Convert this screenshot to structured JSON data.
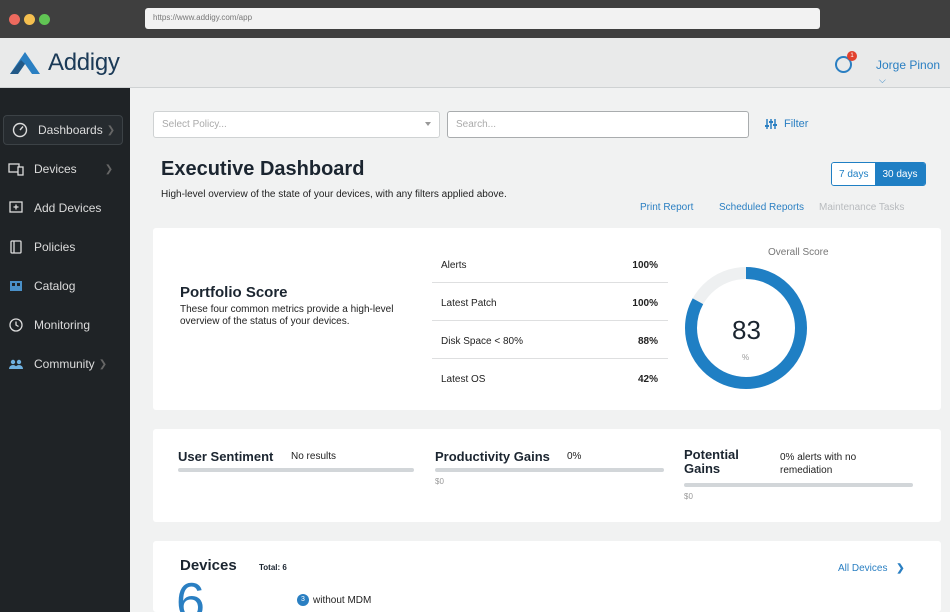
{
  "browser": {
    "url": "https://www.addigy.com/app"
  },
  "header": {
    "app_name": "Addigy",
    "notification_count": "1",
    "user_name": "Jorge Pinon"
  },
  "sidebar": {
    "items": [
      {
        "label": "Dashboards",
        "icon": "gauge-icon"
      },
      {
        "label": "Devices",
        "icon": "devices-icon"
      },
      {
        "label": "Add Devices",
        "icon": "add-device-icon"
      },
      {
        "label": "Policies",
        "icon": "policies-icon"
      },
      {
        "label": "Catalog",
        "icon": "catalog-icon"
      },
      {
        "label": "Monitoring",
        "icon": "clock-icon"
      },
      {
        "label": "Community",
        "icon": "people-icon"
      }
    ]
  },
  "filters": {
    "policy_placeholder": "Select Policy...",
    "search_placeholder": "Search...",
    "filter_label": "Filter"
  },
  "page": {
    "title": "Executive Dashboard",
    "subtitle": "High-level overview of the state of your devices, with any filters applied above.",
    "range_options": [
      "7 days",
      "30 days"
    ],
    "actions": {
      "print": "Print Report",
      "scheduled": "Scheduled Reports",
      "maintenance": "Maintenance Tasks"
    }
  },
  "portfolio": {
    "title": "Portfolio Score",
    "description": "These four common metrics provide a high-level overview of the status of your devices.",
    "metrics": [
      {
        "label": "Alerts",
        "value": "100%"
      },
      {
        "label": "Latest Patch",
        "value": "100%"
      },
      {
        "label": "Disk Space < 80%",
        "value": "88%"
      },
      {
        "label": "Latest OS",
        "value": "42%"
      }
    ],
    "overall_label": "Overall Score",
    "overall_score": "83",
    "overall_unit": "%",
    "overall_fraction": 0.83
  },
  "gains": {
    "user_sentiment": {
      "title": "User Sentiment",
      "side": "No results"
    },
    "productivity": {
      "title": "Productivity Gains",
      "side": "0%",
      "sub": "$0"
    },
    "potential": {
      "title": "Potential Gains",
      "side": "0% alerts with no remediation",
      "sub": "$0"
    }
  },
  "devices": {
    "title": "Devices",
    "total": "Total: 6",
    "all_link": "All Devices",
    "count": "6",
    "without_mdm_count": "3",
    "without_mdm_label": "without MDM"
  },
  "colors": {
    "accent": "#1f7fc4",
    "sidebar": "#1f2326",
    "badge": "#e2412d"
  }
}
